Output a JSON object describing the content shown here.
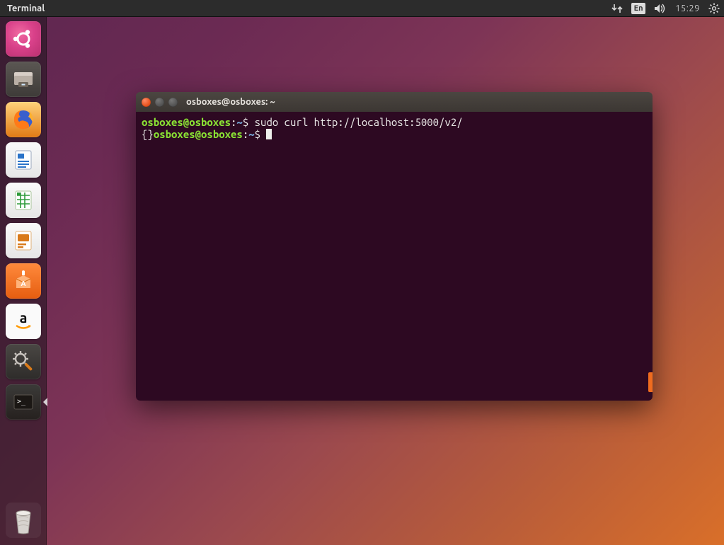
{
  "top_panel": {
    "app_name": "Terminal",
    "lang": "En",
    "time": "15:29"
  },
  "launcher": {
    "items": [
      {
        "name": "dash",
        "label": "Dash"
      },
      {
        "name": "files",
        "label": "Files"
      },
      {
        "name": "firefox",
        "label": "Firefox"
      },
      {
        "name": "writer",
        "label": "LibreOffice Writer"
      },
      {
        "name": "calc",
        "label": "LibreOffice Calc"
      },
      {
        "name": "impress",
        "label": "LibreOffice Impress"
      },
      {
        "name": "software",
        "label": "Ubuntu Software"
      },
      {
        "name": "amazon",
        "label": "Amazon"
      },
      {
        "name": "settings",
        "label": "System Settings"
      },
      {
        "name": "terminal",
        "label": "Terminal"
      }
    ],
    "trash_label": "Trash"
  },
  "terminal": {
    "title": "osboxes@osboxes: ~",
    "prompt": {
      "user_host": "osboxes@osboxes",
      "sep": ":",
      "path": "~",
      "symbol": "$"
    },
    "lines": {
      "cmd1": "sudo curl http://localhost:5000/v2/",
      "output1": "{}"
    }
  }
}
